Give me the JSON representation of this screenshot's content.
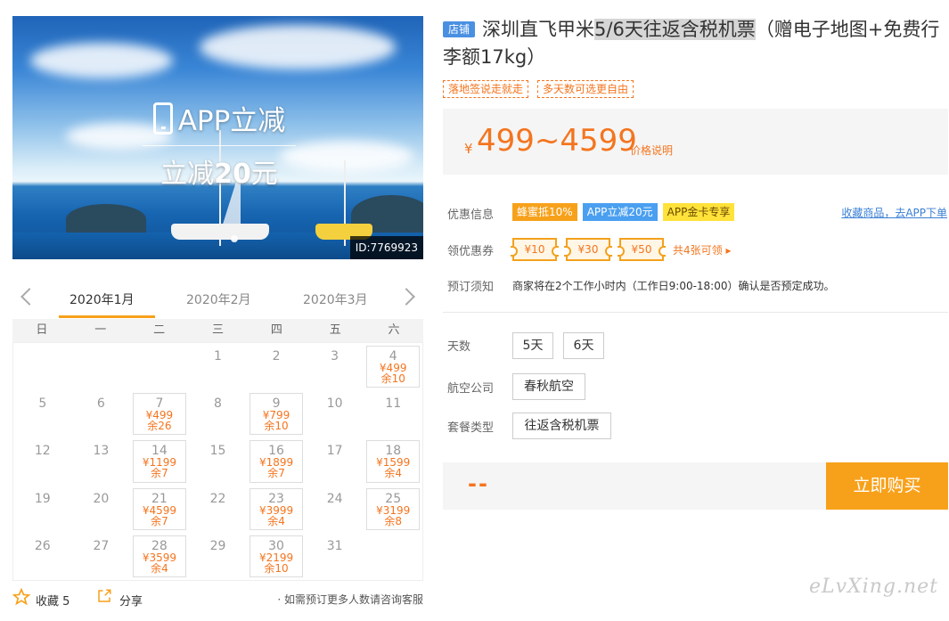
{
  "hero": {
    "promo_line1": "APP立减",
    "promo_line2_prefix": "立减",
    "promo_line2_amount": "20",
    "promo_line2_suffix": "元",
    "id_badge": "ID:7769923"
  },
  "calendar": {
    "months": [
      "2020年1月",
      "2020年2月",
      "2020年3月"
    ],
    "active_month_index": 0,
    "weekdays": [
      "日",
      "一",
      "二",
      "三",
      "四",
      "五",
      "六"
    ],
    "days": [
      {
        "d": "",
        "p": "",
        "s": ""
      },
      {
        "d": "",
        "p": "",
        "s": ""
      },
      {
        "d": "",
        "p": "",
        "s": ""
      },
      {
        "d": "1",
        "p": "",
        "s": ""
      },
      {
        "d": "2",
        "p": "",
        "s": ""
      },
      {
        "d": "3",
        "p": "",
        "s": ""
      },
      {
        "d": "4",
        "p": "¥499",
        "s": "余10"
      },
      {
        "d": "5",
        "p": "",
        "s": ""
      },
      {
        "d": "6",
        "p": "",
        "s": ""
      },
      {
        "d": "7",
        "p": "¥499",
        "s": "余26"
      },
      {
        "d": "8",
        "p": "",
        "s": ""
      },
      {
        "d": "9",
        "p": "¥799",
        "s": "余10"
      },
      {
        "d": "10",
        "p": "",
        "s": ""
      },
      {
        "d": "11",
        "p": "",
        "s": ""
      },
      {
        "d": "12",
        "p": "",
        "s": ""
      },
      {
        "d": "13",
        "p": "",
        "s": ""
      },
      {
        "d": "14",
        "p": "¥1199",
        "s": "余7"
      },
      {
        "d": "15",
        "p": "",
        "s": ""
      },
      {
        "d": "16",
        "p": "¥1899",
        "s": "余7"
      },
      {
        "d": "17",
        "p": "",
        "s": ""
      },
      {
        "d": "18",
        "p": "¥1599",
        "s": "余4"
      },
      {
        "d": "19",
        "p": "",
        "s": ""
      },
      {
        "d": "20",
        "p": "",
        "s": ""
      },
      {
        "d": "21",
        "p": "¥4599",
        "s": "余7"
      },
      {
        "d": "22",
        "p": "",
        "s": ""
      },
      {
        "d": "23",
        "p": "¥3999",
        "s": "余4"
      },
      {
        "d": "24",
        "p": "",
        "s": ""
      },
      {
        "d": "25",
        "p": "¥3199",
        "s": "余8"
      },
      {
        "d": "26",
        "p": "",
        "s": ""
      },
      {
        "d": "27",
        "p": "",
        "s": ""
      },
      {
        "d": "28",
        "p": "¥3599",
        "s": "余4"
      },
      {
        "d": "29",
        "p": "",
        "s": ""
      },
      {
        "d": "30",
        "p": "¥2199",
        "s": "余10"
      },
      {
        "d": "31",
        "p": "",
        "s": ""
      },
      {
        "d": "",
        "p": "",
        "s": ""
      }
    ],
    "favorite_label": "收藏 5",
    "share_label": "分享",
    "consult_text": "· 如需预订更多人数请咨询客服"
  },
  "product": {
    "shop_badge": "店铺",
    "title_part1": "深圳直飞甲米",
    "title_highlight": "5/6天往返含税机票",
    "title_part2": "（赠电子地图+免费行李额17kg）",
    "tags": [
      "落地签说走就走",
      "多天数可选更自由"
    ],
    "price_currency": "¥",
    "price_range": "499~4599",
    "price_explain": "价格说明"
  },
  "offers": {
    "label": "优惠信息",
    "badges": [
      "蜂蜜抵10%",
      "APP立减20元",
      "APP金卡专享"
    ],
    "fav_app_link": "收藏商品，去APP下单",
    "coupon_label": "领优惠券",
    "coupons": [
      "¥10",
      "¥30",
      "¥50"
    ],
    "coupon_more": "共4张可领 ▸",
    "notice_label": "预订须知",
    "notice_text": "商家将在2个工作小时内（工作日9:00-18:00）确认是否预定成功。"
  },
  "options": {
    "days_label": "天数",
    "days": [
      "5天",
      "6天"
    ],
    "airline_label": "航空公司",
    "airline": "春秋航空",
    "package_label": "套餐类型",
    "package": "往返含税机票"
  },
  "buy": {
    "placeholder_price": "--",
    "button_label": "立即购买"
  },
  "watermark": "eLvXing.net",
  "colors": {
    "accent_orange": "#f4751f",
    "buy_button": "#f7a11b",
    "link_blue": "#3a7fd5"
  }
}
